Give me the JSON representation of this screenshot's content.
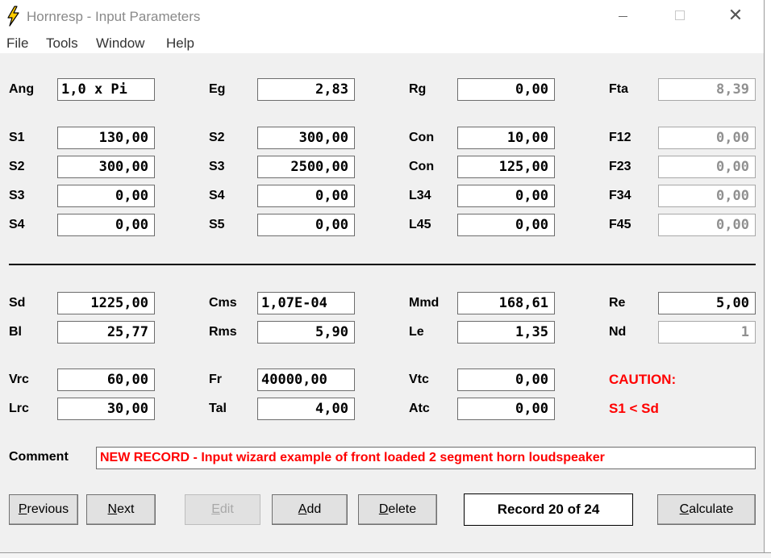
{
  "window": {
    "title": "Hornresp - Input Parameters",
    "close_glyph": "✕"
  },
  "menu": [
    "File",
    "Tools",
    "Window",
    "Help"
  ],
  "row_top": [
    {
      "label": "Ang",
      "value": "1,0 x Pi"
    },
    {
      "label": "Eg",
      "value": "2,83"
    },
    {
      "label": "Rg",
      "value": "0,00"
    },
    {
      "label": "Fta",
      "value": "8,39"
    }
  ],
  "horn_rows": [
    [
      {
        "label": "S1",
        "value": "130,00"
      },
      {
        "label": "S2",
        "value": "300,00"
      },
      {
        "label": "Con",
        "value": "10,00"
      },
      {
        "label": "F12",
        "value": "0,00"
      }
    ],
    [
      {
        "label": "S2",
        "value": "300,00"
      },
      {
        "label": "S3",
        "value": "2500,00"
      },
      {
        "label": "Con",
        "value": "125,00"
      },
      {
        "label": "F23",
        "value": "0,00"
      }
    ],
    [
      {
        "label": "S3",
        "value": "0,00"
      },
      {
        "label": "S4",
        "value": "0,00"
      },
      {
        "label": "L34",
        "value": "0,00"
      },
      {
        "label": "F34",
        "value": "0,00"
      }
    ],
    [
      {
        "label": "S4",
        "value": "0,00"
      },
      {
        "label": "S5",
        "value": "0,00"
      },
      {
        "label": "L45",
        "value": "0,00"
      },
      {
        "label": "F45",
        "value": "0,00"
      }
    ]
  ],
  "driver_rows": [
    [
      {
        "label": "Sd",
        "value": "1225,00"
      },
      {
        "label": "Cms",
        "value": "1,07E-04"
      },
      {
        "label": "Mmd",
        "value": "168,61"
      },
      {
        "label": "Re",
        "value": "5,00"
      }
    ],
    [
      {
        "label": "Bl",
        "value": "25,77"
      },
      {
        "label": "Rms",
        "value": "5,90"
      },
      {
        "label": "Le",
        "value": "1,35"
      },
      {
        "label": "Nd",
        "value": "1"
      }
    ]
  ],
  "chamber_rows": [
    [
      {
        "label": "Vrc",
        "value": "60,00"
      },
      {
        "label": "Fr",
        "value": "40000,00"
      },
      {
        "label": "Vtc",
        "value": "0,00"
      }
    ],
    [
      {
        "label": "Lrc",
        "value": "30,00"
      },
      {
        "label": "Tal",
        "value": "4,00"
      },
      {
        "label": "Atc",
        "value": "0,00"
      }
    ]
  ],
  "caution": {
    "title": "CAUTION:",
    "message": "S1 < Sd"
  },
  "comment": {
    "label": "Comment",
    "value": "NEW RECORD - Input wizard example of front loaded 2 segment horn loudspeaker"
  },
  "buttons": {
    "previous": {
      "u": "P",
      "rest": "revious"
    },
    "next": {
      "u": "N",
      "rest": "ext"
    },
    "edit": {
      "u": "E",
      "rest": "dit"
    },
    "add": {
      "u": "A",
      "rest": "dd"
    },
    "delete": {
      "u": "D",
      "rest": "elete"
    },
    "calculate": {
      "u": "C",
      "rest": "alculate"
    }
  },
  "record": "Record 20 of 24",
  "colors": {
    "warning": "#ff0000",
    "window_bg": "#f0f0f0",
    "disabled": "#909090"
  }
}
